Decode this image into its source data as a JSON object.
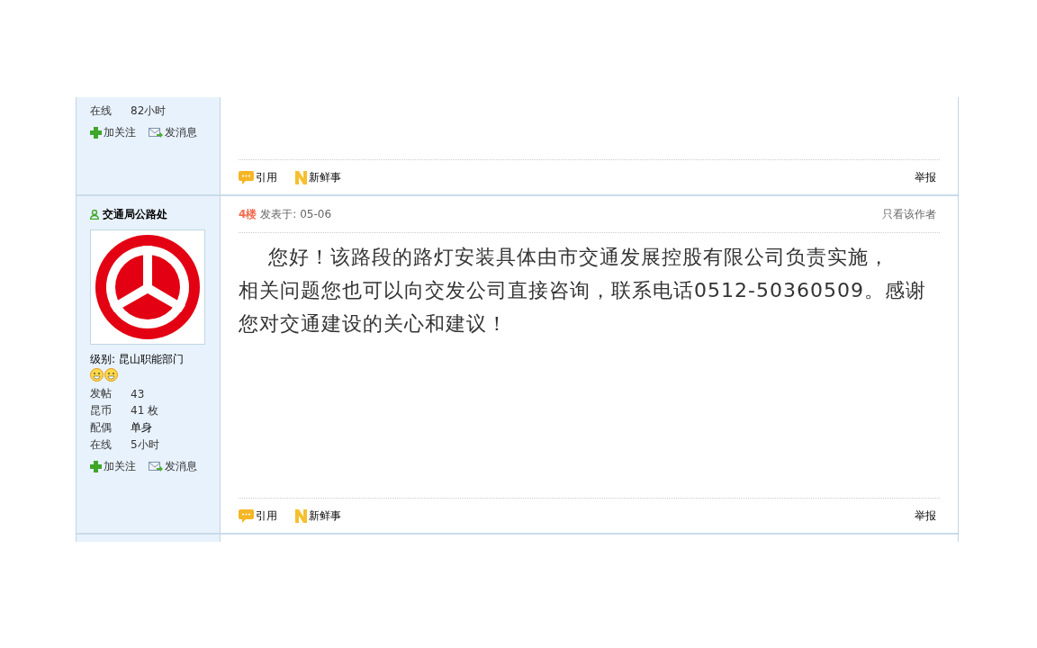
{
  "posts": [
    {
      "stats": [
        {
          "label": "在线",
          "value": "82小时"
        }
      ],
      "actions": [
        "加关注",
        "发消息"
      ],
      "footer": {
        "quote": "引用",
        "share": "新鲜事",
        "report": "举报"
      }
    },
    {
      "author": "交通局公路处",
      "avatar": {
        "kind": "logo"
      },
      "level": "级别: 昆山职能部门",
      "badges": [
        {
          "kind": "smiley"
        },
        {
          "kind": "smiley"
        }
      ],
      "stats": [
        {
          "label": "发帖",
          "value": "43"
        },
        {
          "label": "昆币",
          "value": "41 枚"
        },
        {
          "label": "配偶",
          "value": "单身"
        },
        {
          "label": "在线",
          "value": "5小时"
        }
      ],
      "actions": [
        "加关注",
        "发消息"
      ],
      "floor": "4楼",
      "posted": "发表于: 05-06",
      "only_author": "只看该作者",
      "body": [
        "您好！该路段的路灯安装具体由市交通发展控股有限公司负责实施，",
        "相关问题您也可以向交发公司直接咨询，联系电话0512-50360509。感谢",
        "您对交通建设的关心和建议！"
      ],
      "footer": {
        "quote": "引用",
        "share": "新鲜事",
        "report": "举报"
      }
    }
  ]
}
